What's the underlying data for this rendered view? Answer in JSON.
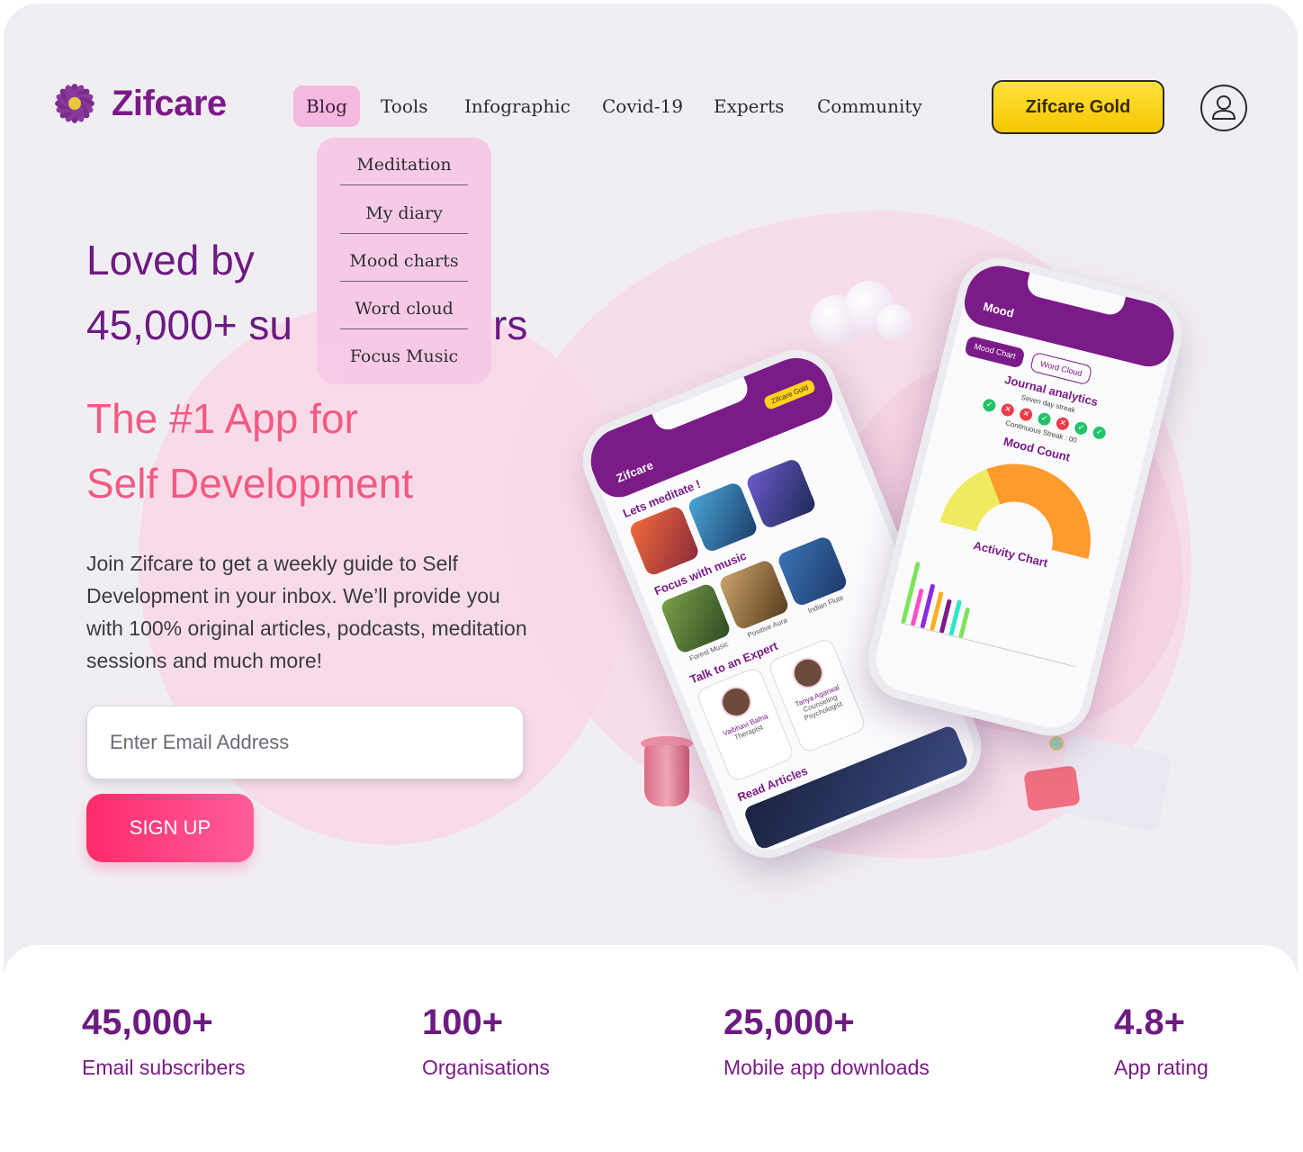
{
  "brand": {
    "name": "Zifcare",
    "accent": "#7b1a86",
    "pink": "#f25a82"
  },
  "nav": {
    "items": [
      "Blog",
      "Tools",
      "Infographic",
      "Covid-19",
      "Experts",
      "Community"
    ],
    "active": "Blog",
    "gold_button": "Zifcare Gold",
    "user_icon": "user-icon"
  },
  "dropdown": {
    "items": [
      "Meditation",
      "My diary",
      "Mood charts",
      "Word cloud",
      "Focus Music"
    ]
  },
  "hero": {
    "line1": "Loved by",
    "line2": "45,000+ su",
    "line2_tail": "rs",
    "tagline1": "The #1 App for",
    "tagline2": "Self Development",
    "description": "Join Zifcare to get a weekly guide to Self Development in your inbox. We’ll provide you with 100% original articles, podcasts, meditation sessions and much more!",
    "email_placeholder": "Enter Email Address",
    "signup_label": "SIGN UP"
  },
  "phone_left": {
    "title": "Zifcare",
    "gold": "Zifcare Gold",
    "section1": "Lets meditate !",
    "section2": "Focus with music",
    "music": [
      "Forest Music",
      "Positive Aura",
      "Indian Flute"
    ],
    "section3": "Talk to an Expert",
    "experts": [
      {
        "name": "Vaibhavi Bafna",
        "role": "Therapist"
      },
      {
        "name": "Tanya Agarwal",
        "role": "Counseling Psychologist"
      }
    ],
    "section4": "Read Articles"
  },
  "phone_right": {
    "title": "Mood",
    "tab_on": "Mood Chart",
    "tab_off": "Word Cloud",
    "journal": "Journal analytics",
    "streak": "Seven day streak",
    "streak_marks": [
      "ok",
      "no",
      "no",
      "ok",
      "no",
      "ok",
      "ok"
    ],
    "continuous": "Continuous Streak : 00",
    "mood_count": "Mood Count",
    "activity": "Activity Chart"
  },
  "stats": [
    {
      "value": "45,000+",
      "label": "Email subscribers"
    },
    {
      "value": "100+",
      "label": "Organisations"
    },
    {
      "value": "25,000+",
      "label": "Mobile app downloads"
    },
    {
      "value": "4.8+",
      "label": "App rating"
    }
  ]
}
